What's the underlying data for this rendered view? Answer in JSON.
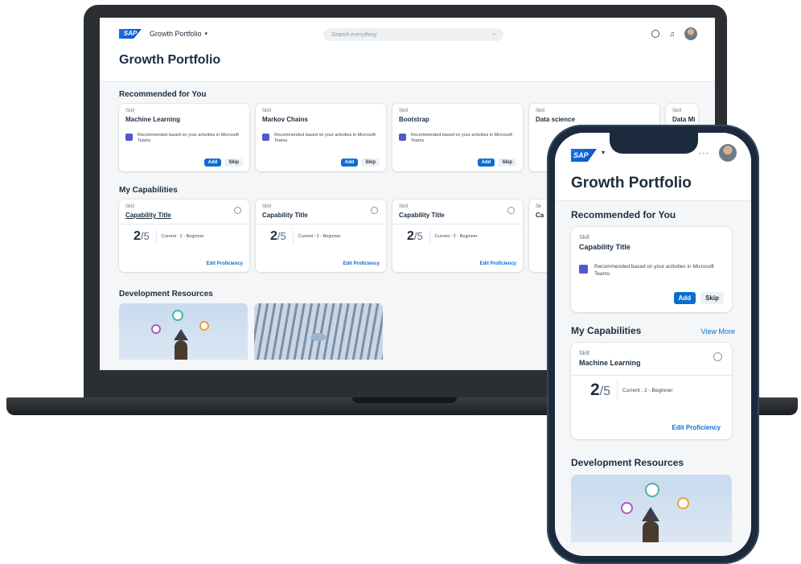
{
  "laptop": {
    "shell": {
      "app_title": "Growth Portfolio",
      "search_placeholder": "Search everything"
    },
    "page_title": "Growth Portfolio",
    "recommended": {
      "title": "Recommended for You",
      "cards": [
        {
          "kind": "Skill",
          "title": "Machine Learning",
          "reason": "Recommended based on your activities in Microsoft Teams",
          "add": "Add",
          "skip": "Skip"
        },
        {
          "kind": "Skill",
          "title": "Markov Chains",
          "reason": "Recommended based on your activities in Microsoft Teams",
          "add": "Add",
          "skip": "Skip"
        },
        {
          "kind": "Skill",
          "title": "Bootstrap",
          "reason": "Recommended based on your activities in Microsoft Teams",
          "add": "Add",
          "skip": "Skip"
        },
        {
          "kind": "Skill",
          "title": "Data science",
          "reason": "",
          "add": "",
          "skip": ""
        },
        {
          "kind": "Skill",
          "title": "Data Mi",
          "reason": "",
          "add": "",
          "skip": ""
        }
      ]
    },
    "capabilities": {
      "title": "My Capabilities",
      "cards": [
        {
          "kind": "Skill",
          "title": "Capability Title",
          "score": "2",
          "max": "/5",
          "current": "Current : 2 - Beginner",
          "edit": "Edit Proficiency"
        },
        {
          "kind": "Skill",
          "title": "Capability Title",
          "score": "2",
          "max": "/5",
          "current": "Current : 2 - Beginner",
          "edit": "Edit Proficiency"
        },
        {
          "kind": "Skill",
          "title": "Capability Title",
          "score": "2",
          "max": "/5",
          "current": "Current : 2 - Beginner",
          "edit": "Edit Proficiency"
        },
        {
          "kind": "Sk",
          "title": "Ca",
          "score": "",
          "max": "",
          "current": "",
          "edit": ""
        }
      ]
    },
    "dev_resources": {
      "title": "Development Resources"
    }
  },
  "phone": {
    "page_title": "Growth Portfolio",
    "recommended": {
      "title": "Recommended for You",
      "card": {
        "kind": "Skill",
        "title": "Capability Title",
        "reason": "Recommended based on your activities in Microsoft Teams",
        "add": "Add",
        "skip": "Skip"
      }
    },
    "capabilities": {
      "title": "My Capabilities",
      "view_more": "View More",
      "card": {
        "kind": "Skill",
        "title": "Machine Learning",
        "score": "2",
        "max": "/5",
        "current": "Current : 2 - Beginner",
        "edit": "Edit Proficiency"
      }
    },
    "dev_resources": {
      "title": "Development Resources"
    },
    "more_icon": "···"
  },
  "logo_text": "SAP",
  "colors": {
    "accent": "#0a6ed1",
    "teams": "#5059c9",
    "device_frame": "#1b2a3c"
  }
}
